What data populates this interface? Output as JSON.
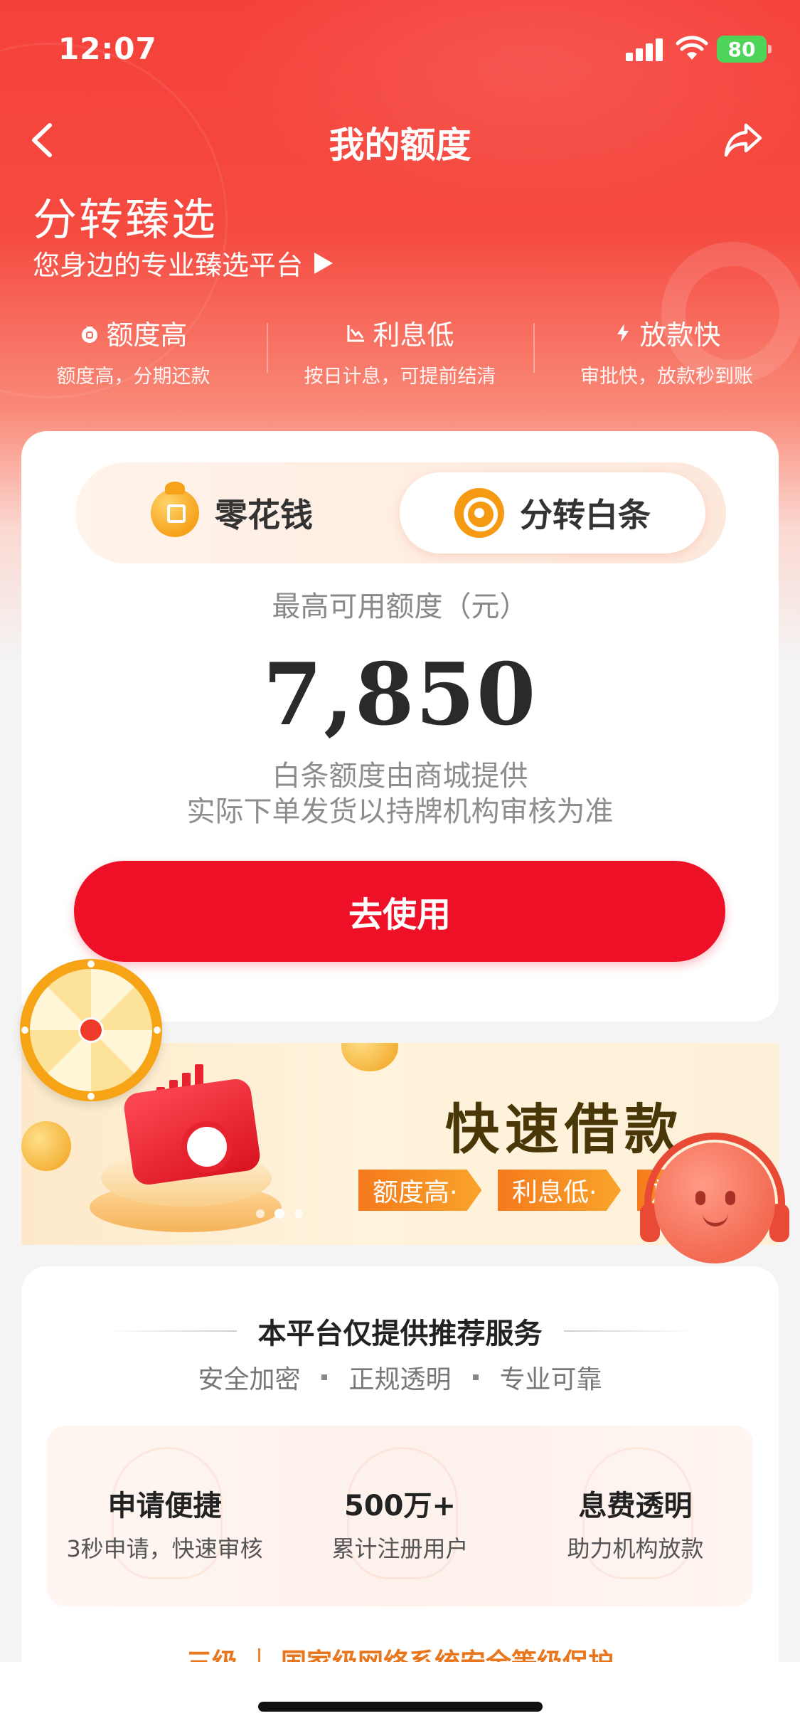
{
  "status_bar": {
    "time": "12:07",
    "battery": "80"
  },
  "nav": {
    "title": "我的额度"
  },
  "hero": {
    "title": "分转臻选",
    "subtitle": "您身边的专业臻选平台"
  },
  "features": [
    {
      "title": "额度高",
      "desc": "额度高，分期还款",
      "icon": "money-bag-icon"
    },
    {
      "title": "利息低",
      "desc": "按日计息，可提前结清",
      "icon": "trend-down-icon"
    },
    {
      "title": "放款快",
      "desc": "审批快，放款秒到账",
      "icon": "lightning-icon"
    }
  ],
  "quota_card": {
    "tabs": [
      {
        "label": "零花钱",
        "selected": false
      },
      {
        "label": "分转白条",
        "selected": true
      }
    ],
    "label": "最高可用额度（元）",
    "amount": "7,850",
    "note_line1": "白条额度由商城提供",
    "note_line2": "实际下单发货以持牌机构审核为准",
    "button": "去使用"
  },
  "banner": {
    "title": "快速借款",
    "tags": [
      "额度高·",
      "利息低·",
      "放"
    ],
    "active_slide": 2,
    "slide_count": 3
  },
  "info_card": {
    "title": "本平台仅提供推荐服务",
    "tags": [
      "安全加密",
      "正规透明",
      "专业可靠"
    ],
    "stats": [
      {
        "title": "申请便捷",
        "desc": "3秒申请，快速审核"
      },
      {
        "title": "500万+",
        "desc": "累计注册用户"
      },
      {
        "title": "息费透明",
        "desc": "助力机构放款"
      }
    ],
    "security_text": "三级 ｜ 国家级网络系统安全等级保护"
  },
  "colors": {
    "brand_red": "#ee1026",
    "header_red": "#f5413b",
    "banner_orange": "#f57a1c",
    "security_orange": "#e8761c"
  }
}
